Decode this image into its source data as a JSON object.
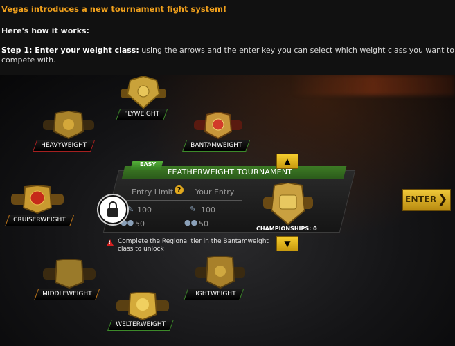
{
  "intro": {
    "headline": "Vegas introduces a new tournament fight system!",
    "how_it_works": "Here's how it works:",
    "step_label": "Step 1: Enter your weight class:",
    "step_text": " using the arrows and the enter key you can select which weight class you want to compete with."
  },
  "weight_classes": {
    "flyweight": "FLYWEIGHT",
    "heavyweight": "HEAVYWEIGHT",
    "bantamweight": "BANTAMWEIGHT",
    "cruiserweight": "CRUISERWEIGHT",
    "middleweight": "MIDDLEWEIGHT",
    "lightweight": "LIGHTWEIGHT",
    "welterweight": "WELTERWEIGHT"
  },
  "panel": {
    "difficulty": "EASY",
    "title": "FEATHERWEIGHT TOURNAMENT",
    "entry_limit_label": "Entry Limit",
    "your_entry_label": "Your Entry",
    "entry_limit_stamina": "100",
    "entry_limit_level": "50",
    "your_entry_stamina": "100",
    "your_entry_level": "50",
    "championships": "CHAMPIONSHIPS: 0",
    "unlock_message": "Complete the Regional tier in the Bantamweight class to unlock"
  },
  "buttons": {
    "up": "▲",
    "down": "▼",
    "enter": "ENTER",
    "enter_chevron": "❯"
  },
  "icons": {
    "lock": "padlock-icon",
    "help": "question-icon",
    "warning": "warning-icon",
    "stamina": "stamina-icon",
    "level": "level-icon"
  },
  "colors": {
    "accent_orange": "#f0a01c",
    "panel_green": "#3d7b25",
    "gold": "#f0c93a"
  }
}
